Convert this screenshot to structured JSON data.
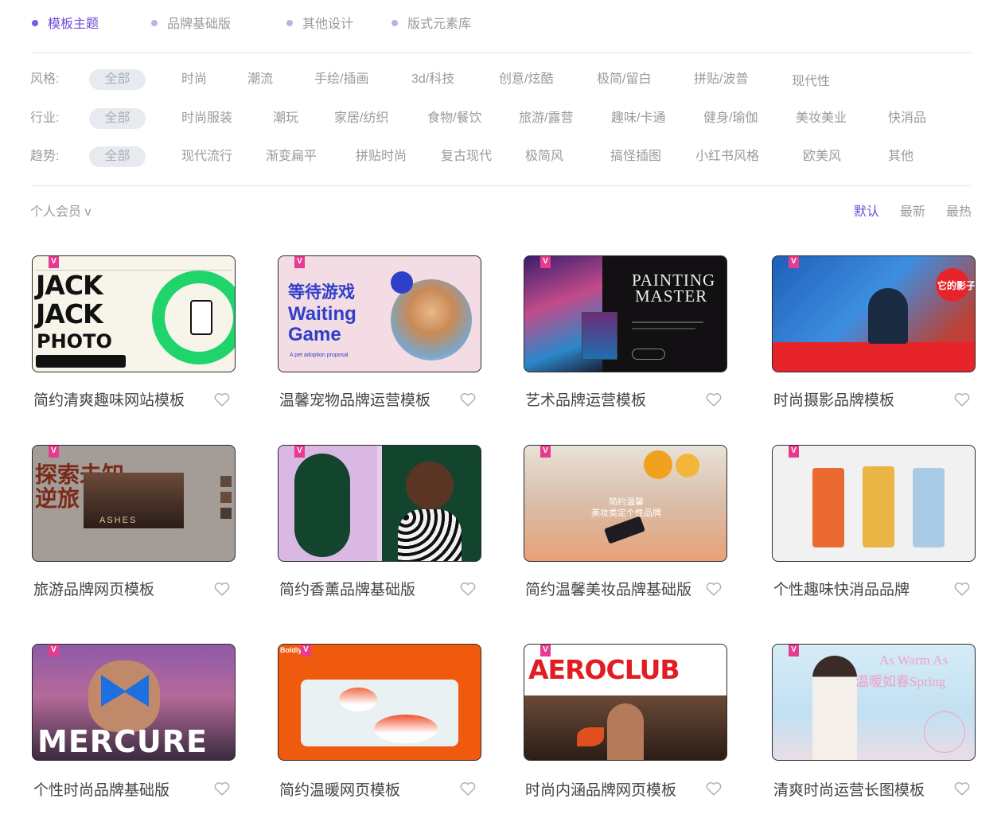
{
  "tabs": [
    "模板主题",
    "品牌基础版",
    "其他设计",
    "版式元素库"
  ],
  "filters": {
    "style": {
      "label": "风格:",
      "options": [
        "全部",
        "时尚",
        "潮流",
        "手绘/插画",
        "3d/科技",
        "创意/炫酷",
        "极简/留白",
        "拼贴/波普",
        "现代性"
      ]
    },
    "industry": {
      "label": "行业:",
      "options": [
        "全部",
        "时尚服装",
        "潮玩",
        "家居/纺织",
        "食物/餐饮",
        "旅游/露营",
        "趣味/卡通",
        "健身/瑜伽",
        "美妆美业",
        "快消品"
      ]
    },
    "trend": {
      "label": "趋势:",
      "options": [
        "全部",
        "现代流行",
        "渐变扁平",
        "拼贴时尚",
        "复古现代",
        "极简风",
        "搞怪插图",
        "小红书风格",
        "欧美风",
        "其他"
      ]
    }
  },
  "member_filter": "个人会员 v",
  "sort": {
    "options": [
      "默认",
      "最新",
      "最热"
    ],
    "selected": "默认"
  },
  "vip_badge": "V",
  "templates": [
    {
      "title": "简约清爽趣味网站模板",
      "thumb_text": [
        "JACK",
        "JACK",
        "PHOTO"
      ]
    },
    {
      "title": "温馨宠物品牌运营模板",
      "thumb_text": [
        "等待游戏",
        "Waiting",
        "Game",
        "A pet adoption proposal"
      ]
    },
    {
      "title": "艺术品牌运营模板",
      "thumb_text": [
        "PAINTING",
        "MASTER"
      ]
    },
    {
      "title": "时尚摄影品牌模板",
      "thumb_text": [
        "它的影子"
      ]
    },
    {
      "title": "旅游品牌网页模板",
      "thumb_text": [
        "探索未知",
        "逆旅",
        "ASHES"
      ]
    },
    {
      "title": "简约香薰品牌基础版",
      "thumb_text": []
    },
    {
      "title": "简约温馨美妆品牌基础版",
      "thumb_text": [
        "简约温馨",
        "美妆类定个性品牌"
      ]
    },
    {
      "title": "个性趣味快消品品牌",
      "thumb_text": []
    },
    {
      "title": "个性时尚品牌基础版",
      "thumb_text": [
        "MERCURE"
      ]
    },
    {
      "title": "简约温暖网页模板",
      "thumb_text": [
        "Boldly"
      ]
    },
    {
      "title": "时尚内涵品牌网页模板",
      "thumb_text": [
        "AEROCLUB"
      ]
    },
    {
      "title": "清爽时尚运营长图模板",
      "thumb_text": [
        "As Warm As",
        "温暖如春Spring"
      ]
    }
  ],
  "colors": {
    "accent": "#6c4ad8",
    "vip": "#e83a8e",
    "muted": "#9a9a9a"
  }
}
